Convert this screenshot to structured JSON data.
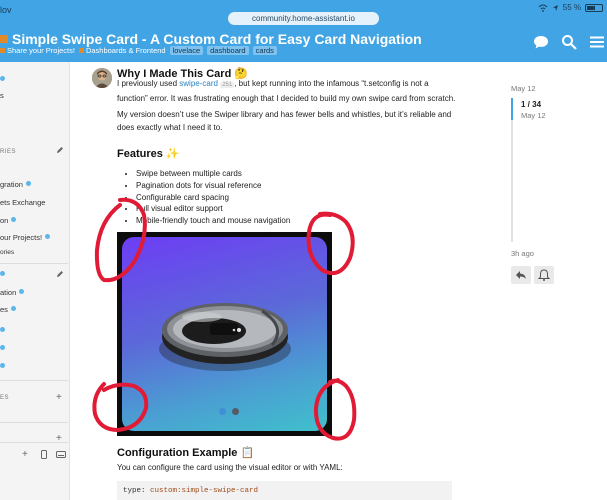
{
  "status_bar": {
    "time_fragment": "lov",
    "battery": "55 %"
  },
  "address_bar": {
    "url": "community.home-assistant.io"
  },
  "topic": {
    "title": "Simple Swipe Card - A Custom Card for Easy Card Navigation",
    "breadcrumb": {
      "category": "Share your Projects!",
      "subcategory": "Dashboards & Frontend",
      "tags": [
        "lovelace",
        "dashboard",
        "cards"
      ]
    }
  },
  "sidebar": {
    "top_items": [
      {
        "label": "s"
      }
    ],
    "categories_heading": "RIES",
    "category_items": [
      {
        "label": "gration"
      },
      {
        "label": "ets Exchange"
      },
      {
        "label": "on"
      },
      {
        "label": "our Projects!"
      },
      {
        "label": "ories"
      }
    ],
    "tag_items": [
      {
        "label": "ation"
      },
      {
        "label": "es"
      }
    ],
    "messages_heading": "ES"
  },
  "post": {
    "heading": "Why I Made This Card 🤔",
    "para1": {
      "prefix": "I previously used ",
      "link": "swipe-card",
      "link_count": "251",
      "line1_rest": ", but kept running into the infamous “t.setconfig is not a",
      "line2": "function” error. It was frustrating enough that I decided to build my own swipe card from scratch."
    },
    "para2": {
      "line1": "My version doesn’t use the Swiper library and has fewer bells and whistles, but it’s reliable and",
      "line2": "does exactly what I need it to."
    },
    "features_heading": "Features ✨",
    "features": [
      "Swipe between multiple cards",
      "Pagination dots for visual reference",
      "Configurable card spacing",
      "Full visual editor support",
      "Mobile-friendly touch and mouse navigation"
    ],
    "config_heading": "Configuration Example 📋",
    "config_text": "You can configure the card using the visual editor or with YAML:",
    "code": {
      "key": "type:",
      "value": "custom:simple-swipe-card"
    }
  },
  "timeline": {
    "start_date": "May 12",
    "position": "1 / 34",
    "current_date": "May 12",
    "end_label": "3h ago"
  },
  "colors": {
    "header": "#41a4e4",
    "link": "#2a80c1",
    "annotation": "#e11b35"
  }
}
